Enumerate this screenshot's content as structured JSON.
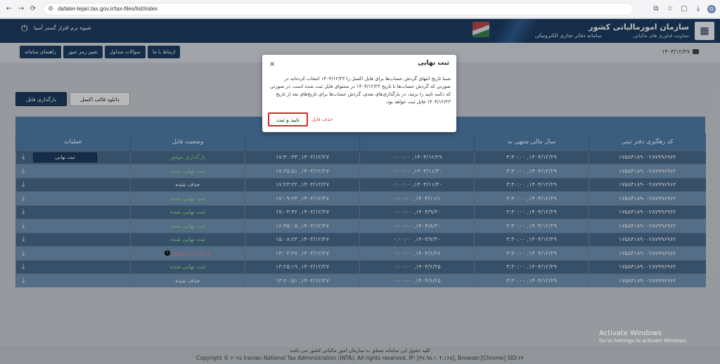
{
  "browser": {
    "url": "dafater-tejari.tax.gov.ir/tax-files/list/index",
    "back": "←",
    "forward": "→",
    "reload": "⟳",
    "site": "⚙",
    "right_icons": [
      "⧉",
      "☆",
      "▢",
      "⤓"
    ],
    "avatar": "G"
  },
  "header": {
    "brand_title": "سازمان امورمالیاتی کشور",
    "brand_sub": "معاونت فناوری های مالیاتی",
    "system_name": "سامانه دفاتر تجاری الکترونیکی",
    "username": "شیوه نرم افزار گستر آسیا",
    "power_icon": "⏻",
    "logo": "▦"
  },
  "menu": {
    "items": [
      "راهنمای سامانه",
      "تغییر رمز عبور",
      "سوالات متداول",
      "ارتباط با ما"
    ]
  },
  "date": "۱۴۰۳/۱۲/۲۷",
  "actions": {
    "upload": "بارگذاری فایل",
    "template": "دانلود قالب اکسل"
  },
  "table": {
    "headers": [
      "کد رهگیری دفتر ثبتی",
      "سال مالی منتهی به",
      "",
      "",
      "وضعیت فایل",
      "عملیات"
    ],
    "rows": [
      {
        "code": "۱۷۵۸۴۱۸۹۰۰۲۸۷۹۹۶۹۶۲",
        "fy": "۳:۳۰:۰۰ ,۱۴۰۴/۱۲/۲۹",
        "period": "۰:۰۰:۰۰ ,۱۴۰۴/۱۲/۲۹",
        "upload": "۱۷:۴۰:۳۳ ,۱۴۰۳/۱۲/۲۷",
        "status": "بارگذاری موفق",
        "status_class": "st-success",
        "op": "ثبت نهایی"
      },
      {
        "code": "۱۷۵۸۴۱۸۹۰۰۲۸۷۹۹۶۹۶۲",
        "fy": "۳:۳۰:۰۰ ,۱۴۰۴/۱۲/۲۹",
        "period": "۰:۰۰:۰۰ ,۱۴۰۴/۱۱/۳۰",
        "upload": "۱۷:۲۵:۵۱ ,۱۴۰۳/۱۲/۲۷",
        "status": "ثبت نهایی شده",
        "status_class": "st-final",
        "op": ""
      },
      {
        "code": "۱۷۵۸۴۱۸۹۰۰۲۸۷۹۹۶۹۶۲",
        "fy": "۳:۳۰:۰۰ ,۱۴۰۴/۱۲/۲۹",
        "period": "۰:۰۰:۰۰ ,۱۴۰۴/۱۱/۳۰",
        "upload": "۱۷:۲۳:۲۲ ,۱۴۰۳/۱۲/۲۷",
        "status": "حذف شده",
        "status_class": "st-deleted",
        "op": ""
      },
      {
        "code": "۱۷۵۸۴۱۸۹۰۰۲۸۷۹۹۶۹۶۲",
        "fy": "۳:۳۰:۰۰ ,۱۴۰۴/۱۲/۲۹",
        "period": "۰:۰۰:۰۰ ,۱۴۰۴/۱۱/۱",
        "upload": "۱۷:۰۹:۲۳ ,۱۴۰۳/۱۲/۲۷",
        "status": "ثبت نهایی شده",
        "status_class": "st-final",
        "op": ""
      },
      {
        "code": "۱۷۵۸۴۱۸۹۰۰۲۸۷۹۹۶۹۶۲",
        "fy": "۳:۳۰:۰۰ ,۱۴۰۴/۱۲/۲۹",
        "period": "۰:۰۰:۰۰ ,۱۴۰۴/۹/۳۰",
        "upload": "۱۷:۰۳:۴۲ ,۱۴۰۳/۱۲/۲۷",
        "status": "ثبت نهایی شده",
        "status_class": "st-final",
        "op": ""
      },
      {
        "code": "۱۷۵۸۴۱۸۹۰۰۲۸۷۹۹۶۹۶۲",
        "fy": "۳:۳۰:۰۰ ,۱۴۰۴/۱۲/۲۹",
        "period": "۰:۰۰:۰۰ ,۱۴۰۴/۸/۳۰",
        "upload": "۱۶:۴۵:۰۵ ,۱۴۰۳/۱۲/۲۷",
        "status": "ثبت نهایی شده",
        "status_class": "st-final",
        "op": ""
      },
      {
        "code": "۱۷۵۸۴۱۸۹۰۰۲۸۷۹۹۶۹۶۲",
        "fy": "۳:۳۰:۰۰ ,۱۴۰۴/۱۲/۲۹",
        "period": "۰:۰۰:۰۰ ,۱۴۰۴/۷/۳۰",
        "upload": "۱۵:۰۸:۲۳ ,۱۴۰۳/۱۲/۲۷",
        "status": "ثبت نهایی شده",
        "status_class": "st-final",
        "op": ""
      },
      {
        "code": "۱۷۵۸۴۱۸۹۰۰۲۸۷۹۹۶۹۶۲",
        "fy": "۳:۳۰:۰۰ ,۱۴۰۴/۱۲/۲۹",
        "period": "۰:۰۰:۰۰ ,۱۴۰۴/۶/۲۶",
        "upload": "۱۴:۰۲:۲۷ ,۱۴۰۳/۱۲/۲۷",
        "status": "بارگذاری ناموفق",
        "status_class": "st-failed",
        "op": ""
      },
      {
        "code": "۱۷۵۸۴۱۸۹۰۰۲۸۷۹۹۶۹۶۲",
        "fy": "۳:۳۰:۰۰ ,۱۴۰۴/۱۲/۲۹",
        "period": "۰:۰۰:۰۰ ,۱۴۰۴/۶/۲۵",
        "upload": "۱۳:۲۵:۱۹ ,۱۴۰۳/۱۲/۲۷",
        "status": "ثبت نهایی شده",
        "status_class": "st-final",
        "op": ""
      },
      {
        "code": "۱۷۵۸۴۱۸۹۰۰۲۸۷۹۹۶۹۶۲",
        "fy": "۳:۳۰:۰۰ ,۱۴۰۴/۱۲/۲۹",
        "period": "۰:۰۰:۰۰ ,۱۴۰۴/۶/۲۵",
        "upload": "۱۳:۲۰:۵۱ ,۱۴۰۳/۱۲/۲۷",
        "status": "حذف شده",
        "status_class": "st-deleted",
        "op": ""
      }
    ],
    "download_icon": "⤓",
    "info_icon": "!"
  },
  "modal": {
    "title": "ثبت نهایی",
    "close": "×",
    "body": "شما تاریخ انتهای گردش حساب‌ها برای فایل اکسل را ۱۴۰۴/۱۲/۲۳ انتخاب کرده‌اید در صورتی که گردش حساب‌ها تا تاریخ ۱۴۰۴/۱۲/۲۳ در محتوای فایل ثبت شده است. در صورتی که دکمه تایید را بزنید، در بارگذاری‌های بعدی، گردش حساب‌ها برای تاریخ‌های بعد از تاریخ ۱۴۰۴/۱۲/۲۳ قابل ثبت خواهد بود.",
    "confirm": "تایید و ثبت",
    "delete": "حذف فایل"
  },
  "footer": {
    "line1": "کلیه حقوق این سامانه متعلق به سازمان امور مالیاتی کشور می باشد",
    "line2": "Copyright © ۲۰۲۵ Iranian National Tax Administration (INTA). All rights reserved. IP: [۳۷.۹۸.۱۰۴.۱۶۸], Browser:[Chrome] SID:۶۳"
  },
  "watermark": {
    "line1": "Activate Windows",
    "line2": "Go to Settings to activate Windows."
  }
}
